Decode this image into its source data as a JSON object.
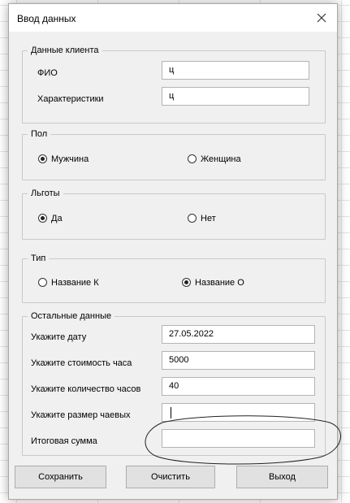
{
  "window": {
    "title": "Ввод данных",
    "close_icon": "close-icon"
  },
  "client": {
    "legend": "Данные клиента",
    "fio_label": "ФИО",
    "fio_value": "ц",
    "char_label": "Характеристики",
    "char_value": "ц"
  },
  "gender": {
    "legend": "Пол",
    "options": [
      {
        "label": "Мужчина",
        "checked": true
      },
      {
        "label": "Женщина",
        "checked": false
      }
    ]
  },
  "benefits": {
    "legend": "Льготы",
    "options": [
      {
        "label": "Да",
        "checked": true
      },
      {
        "label": "Нет",
        "checked": false
      }
    ]
  },
  "type": {
    "legend": "Тип",
    "options": [
      {
        "label": "Название К",
        "checked": false
      },
      {
        "label": "Название О",
        "checked": true
      }
    ]
  },
  "other": {
    "legend": "Остальные данные",
    "fields": [
      {
        "label": "Укажите дату",
        "value": "27.05.2022"
      },
      {
        "label": "Укажите стоимость часа",
        "value": "5000"
      },
      {
        "label": "Укажите количество часов",
        "value": "40"
      },
      {
        "label": "Укажите размер чаевых",
        "value": ""
      },
      {
        "label": "Итоговая сумма",
        "value": ""
      }
    ]
  },
  "buttons": {
    "save": "Сохранить",
    "clear": "Очистить",
    "exit": "Выход"
  }
}
